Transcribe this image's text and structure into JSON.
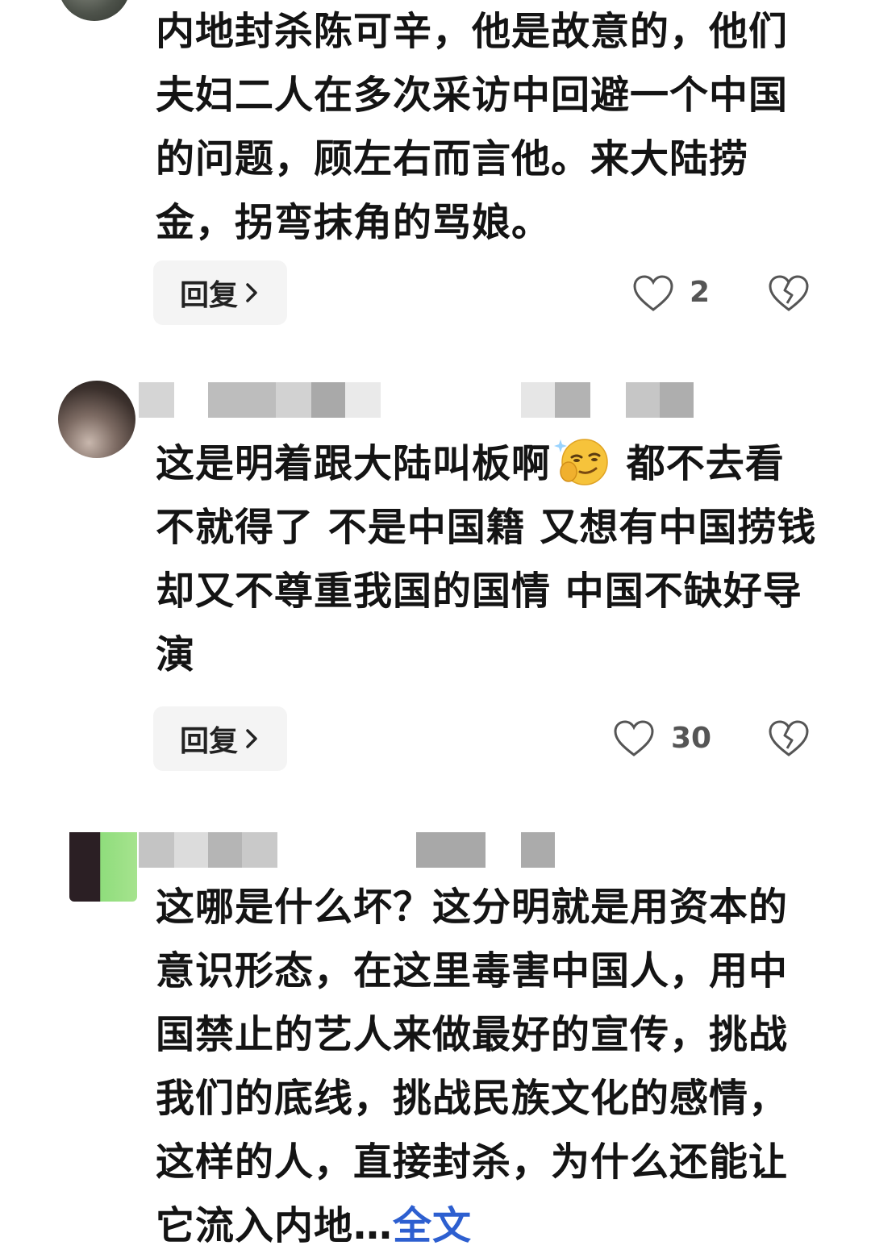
{
  "comments": [
    {
      "text": "内地封杀陈可辛，他是故意的，他们夫妇二人在多次采访中回避一个中国的问题，顾左右而言他。来大陆捞金，拐弯抹角的骂娘。",
      "reply_label": "回复",
      "like_count": "2"
    },
    {
      "text_parts": [
        "这是明着跟大陆叫板啊",
        " 都不去看不就得了 不是中国籍 又想有中国捞钱 却又不尊重我国的国情 中国不缺好导演"
      ],
      "reply_label": "回复",
      "like_count": "30"
    },
    {
      "text": "这哪是什么坏？这分明就是用资本的意识形态，在这里毒害中国人，用中国禁止的艺人来做最好的宣传，挑战我们的底线，挑战民族文化的感情，这样的人，直接封杀，为什么还能让它流入内地…",
      "more_label": "全文"
    }
  ],
  "icons": {
    "like": "heart-outline-icon",
    "dislike": "broken-heart-icon",
    "reply_arrow": "chevron-right-icon",
    "emoji": "smirk-face-emoji"
  },
  "colors": {
    "text": "#141414",
    "link": "#2d5fd0",
    "reply_bg": "#f4f4f4",
    "icon": "#555555"
  }
}
